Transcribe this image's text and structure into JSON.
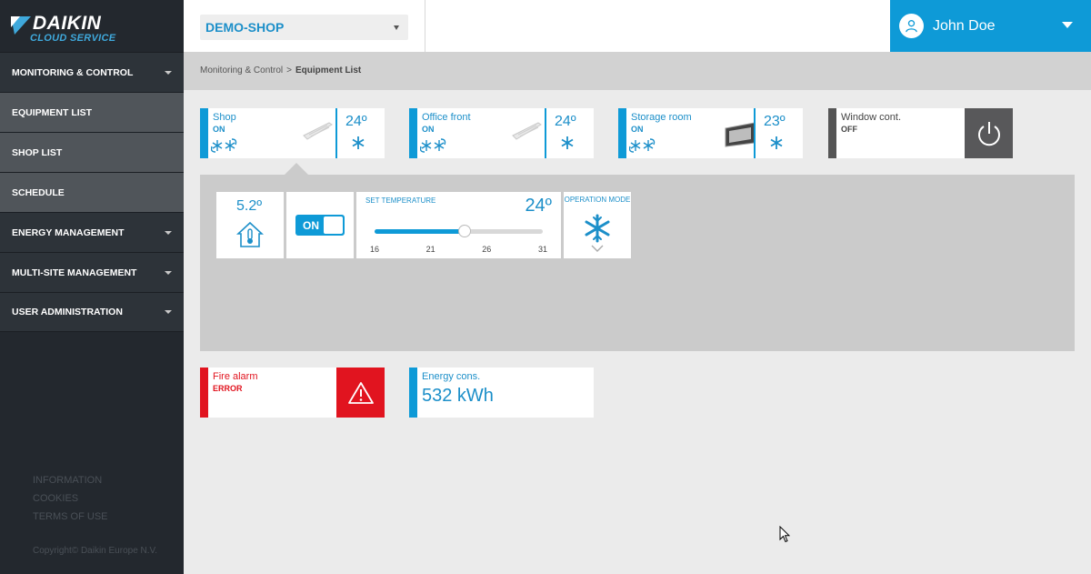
{
  "brand": {
    "title": "DAIKIN",
    "subtitle": "CLOUD SERVICE"
  },
  "sidebar": {
    "items": [
      {
        "label": "MONITORING & CONTROL",
        "has_caret": true
      },
      {
        "label": "EQUIPMENT LIST",
        "has_caret": false
      },
      {
        "label": "SHOP LIST",
        "has_caret": false
      },
      {
        "label": "SCHEDULE",
        "has_caret": false
      },
      {
        "label": "ENERGY MANAGEMENT",
        "has_caret": true
      },
      {
        "label": "MULTI-SITE MANAGEMENT",
        "has_caret": true
      },
      {
        "label": "USER ADMINISTRATION",
        "has_caret": true
      }
    ],
    "footer_links": [
      "INFORMATION",
      "COOKIES",
      "TERMS OF USE"
    ],
    "copyright": "Copyright© Daikin Europe N.V."
  },
  "topbar": {
    "shop_select": "DEMO-SHOP",
    "user_name": "John Doe"
  },
  "breadcrumb": {
    "parent": "Monitoring & Control",
    "separator": ">",
    "current": "Equipment List"
  },
  "equipment": [
    {
      "name": "Shop",
      "status": "ON",
      "temp": "24º",
      "mode_icon": "cool-mode-icon",
      "unit_icon": "cassette-unit-icon"
    },
    {
      "name": "Office front",
      "status": "ON",
      "temp": "24º",
      "mode_icon": "cool-mode-icon",
      "unit_icon": "cassette-unit-icon"
    },
    {
      "name": "Storage room",
      "status": "ON",
      "temp": "23º",
      "mode_icon": "cool-mode-icon",
      "unit_icon": "wall-unit-icon"
    },
    {
      "name": "Window cont.",
      "status": "OFF",
      "icon": "power-icon"
    }
  ],
  "detail": {
    "room_temp": "5.2º",
    "power_toggle": "ON",
    "set_temperature_label": "SET TEMPERATURE",
    "set_temperature": "24º",
    "slider": {
      "min": 16,
      "max": 31,
      "value": 24,
      "ticks": [
        "16",
        "21",
        "26",
        "31"
      ]
    },
    "operation_mode_label": "OPERATION MODE",
    "operation_mode_icon": "snowflake-icon"
  },
  "alarm": {
    "name": "Fire alarm",
    "status": "ERROR",
    "icon": "warning-icon"
  },
  "energy": {
    "label": "Energy cons.",
    "value": "532 kWh"
  },
  "colors": {
    "accent": "#0e9ad7",
    "sidebar": "#23282e",
    "error": "#e1141f",
    "off": "#58585a"
  }
}
